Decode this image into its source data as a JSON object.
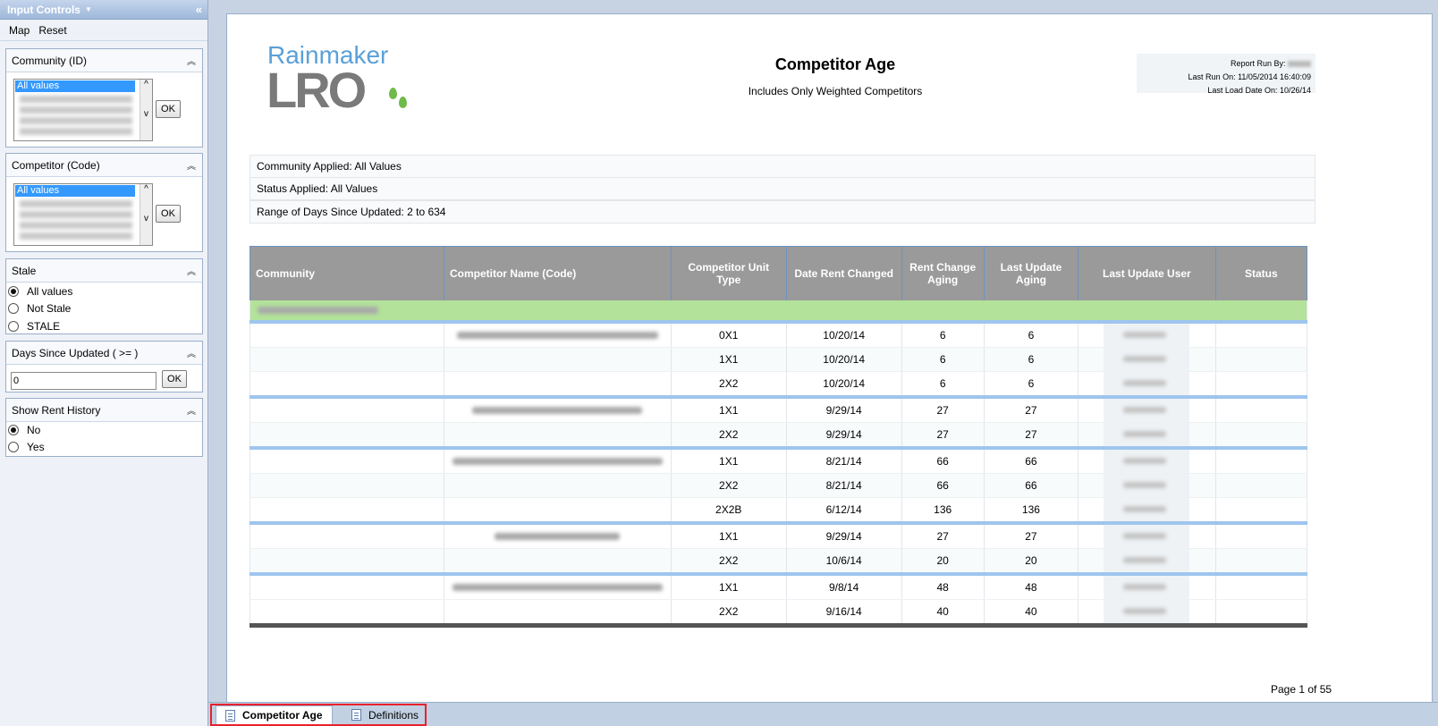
{
  "left_panel": {
    "title": "Input Controls",
    "menu": {
      "map": "Map",
      "reset": "Reset"
    },
    "community": {
      "label": "Community (ID)",
      "selected": "All values",
      "ok": "OK"
    },
    "competitor": {
      "label": "Competitor (Code)",
      "selected": "All values",
      "ok": "OK"
    },
    "stale": {
      "label": "Stale",
      "options": [
        "All values",
        "Not Stale",
        "STALE"
      ],
      "selected": "All values"
    },
    "days": {
      "label": "Days Since Updated ( >= )",
      "value": "0",
      "ok": "OK"
    },
    "rent_history": {
      "label": "Show Rent History",
      "options": [
        "No",
        "Yes"
      ],
      "selected": "No"
    }
  },
  "report": {
    "logo": {
      "top": "Rainmaker",
      "bottom": "LRO"
    },
    "title": "Competitor Age",
    "subtitle": "Includes Only Weighted Competitors",
    "run_info": {
      "run_by": "Report Run By:",
      "last_run": "Last Run On: 11/05/2014 16:40:09",
      "last_load": "Last Load Date On: 10/26/14"
    },
    "filters": [
      "Community Applied: All Values",
      "Status Applied: All Values",
      "Range of Days Since Updated: 2 to 634"
    ],
    "columns": [
      "Community",
      "Competitor Name (Code)",
      "Competitor Unit Type",
      "Date Rent Changed",
      "Rent Change Aging",
      "Last Update Aging",
      "Last Update User",
      "Status"
    ],
    "rows": [
      {
        "unit": "0X1",
        "date": "10/20/14",
        "rent_aging": "6",
        "update_aging": "6"
      },
      {
        "unit": "1X1",
        "date": "10/20/14",
        "rent_aging": "6",
        "update_aging": "6"
      },
      {
        "unit": "2X2",
        "date": "10/20/14",
        "rent_aging": "6",
        "update_aging": "6"
      },
      {
        "unit": "1X1",
        "date": "9/29/14",
        "rent_aging": "27",
        "update_aging": "27"
      },
      {
        "unit": "2X2",
        "date": "9/29/14",
        "rent_aging": "27",
        "update_aging": "27"
      },
      {
        "unit": "1X1",
        "date": "8/21/14",
        "rent_aging": "66",
        "update_aging": "66"
      },
      {
        "unit": "2X2",
        "date": "8/21/14",
        "rent_aging": "66",
        "update_aging": "66"
      },
      {
        "unit": "2X2B",
        "date": "6/12/14",
        "rent_aging": "136",
        "update_aging": "136"
      },
      {
        "unit": "1X1",
        "date": "9/29/14",
        "rent_aging": "27",
        "update_aging": "27"
      },
      {
        "unit": "2X2",
        "date": "10/6/14",
        "rent_aging": "20",
        "update_aging": "20"
      },
      {
        "unit": "1X1",
        "date": "9/8/14",
        "rent_aging": "48",
        "update_aging": "48"
      },
      {
        "unit": "2X2",
        "date": "9/16/14",
        "rent_aging": "40",
        "update_aging": "40"
      }
    ],
    "page": "Page 1 of 55"
  },
  "tabs": [
    "Competitor Age",
    "Definitions"
  ]
}
